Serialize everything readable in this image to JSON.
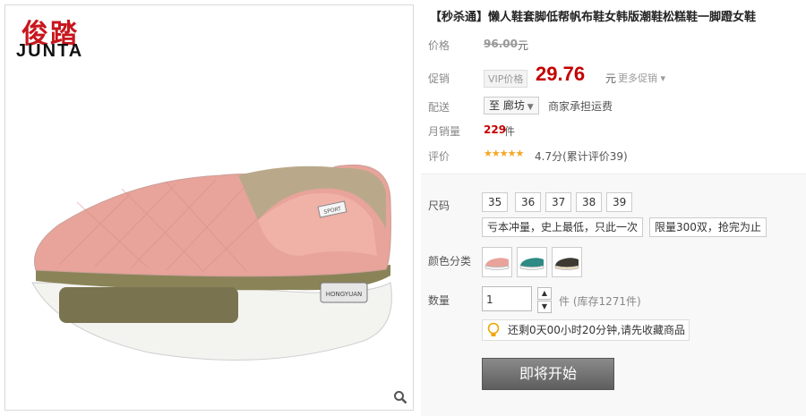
{
  "brand": {
    "name_cn": "俊踏",
    "name_en": "JUNTA"
  },
  "product": {
    "title": "【秒杀通】懒人鞋套脚低帮帆布鞋女韩版潮鞋松糕鞋一脚蹬女鞋",
    "price_label": "价格",
    "original_price": "96.00",
    "currency_unit": "元",
    "promo_label": "促销",
    "vip_badge": "VIP价格",
    "promo_price": "29.76",
    "more_promo": "更多促销",
    "shipping_label": "配送",
    "shipping_dest": "至 廊坊",
    "shipping_note": "商家承担运费",
    "monthly_sales_label": "月销量",
    "monthly_sales_value": "229",
    "monthly_sales_unit": "件",
    "rating_label": "评价",
    "rating_stars": "★★★★★",
    "rating_text": "4.7分(累计评价39)"
  },
  "sku": {
    "size_label": "尺码",
    "sizes": [
      "35",
      "36",
      "37",
      "38",
      "39"
    ],
    "tags": [
      "亏本冲量，史上最低，只此一次",
      "限量300双，抢完为止"
    ],
    "color_label": "颜色分类",
    "quantity_label": "数量",
    "quantity_value": "1",
    "stock_text": "件 (库存1271件)",
    "countdown_text": "还剩0天00小时20分钟,请先收藏商品",
    "buy_button": "即将开始"
  },
  "colors": {
    "accent_red": "#c40000",
    "brand_red": "#c8161d",
    "swatches": [
      "#e8a39a",
      "#2e8a84",
      "#3d3a33"
    ]
  },
  "icons": {
    "zoom": "magnifier-icon",
    "bulb": "lightbulb-icon",
    "dropdown": "caret-down-icon"
  }
}
